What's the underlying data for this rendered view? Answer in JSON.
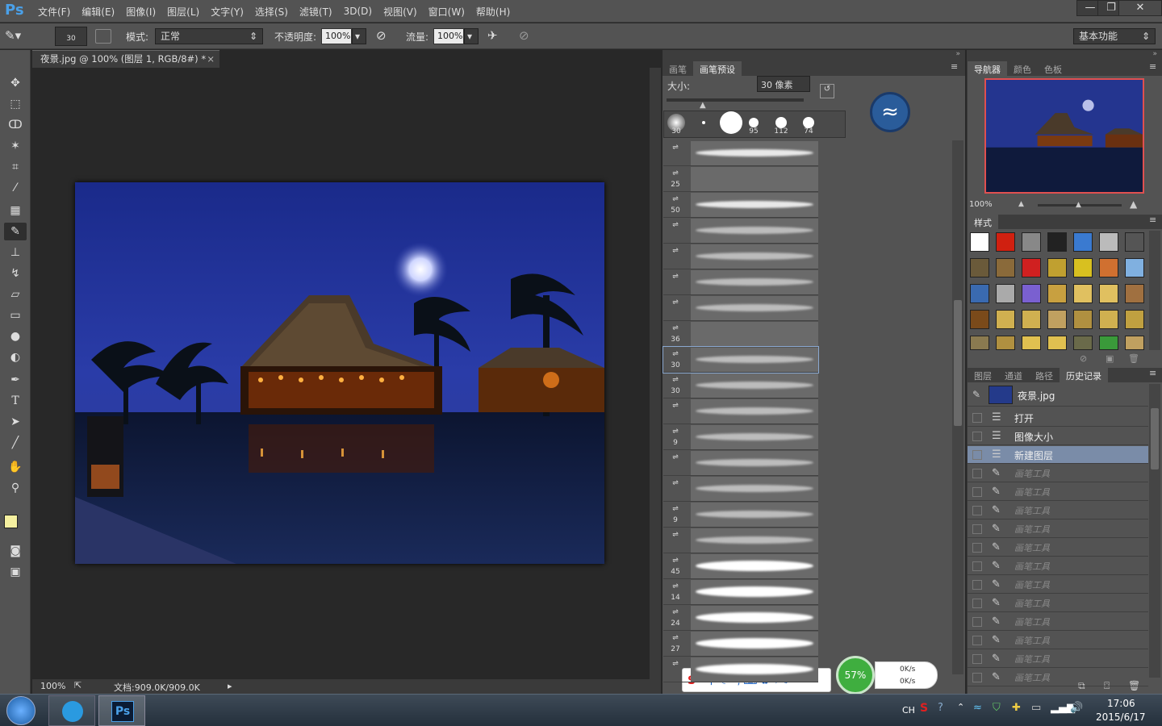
{
  "app": {
    "logo": "Ps"
  },
  "menu": [
    "文件(F)",
    "编辑(E)",
    "图像(I)",
    "图层(L)",
    "文字(Y)",
    "选择(S)",
    "滤镜(T)",
    "3D(D)",
    "视图(V)",
    "窗口(W)",
    "帮助(H)"
  ],
  "window_controls": {
    "minimize": "—",
    "restore": "❐",
    "close": "✕"
  },
  "options": {
    "brush_size": "30",
    "mode_label": "模式:",
    "mode_value": "正常",
    "opacity_label": "不透明度:",
    "opacity_value": "100%",
    "flow_label": "流量:",
    "flow_value": "100%",
    "workspace": "基本功能"
  },
  "document": {
    "tab_title": "夜景.jpg @ 100% (图层 1, RGB/8#) *",
    "zoom": "100%",
    "doc_info": "文档:909.0K/909.0K"
  },
  "brush_panel": {
    "tabs": [
      "画笔",
      "画笔预设"
    ],
    "active_tab": "画笔预设",
    "size_label": "大小:",
    "size_value": "30 像素",
    "top_presets": [
      "30",
      "",
      "",
      "95",
      "112",
      "74"
    ],
    "rows": [
      "",
      "25",
      "50",
      "",
      "",
      "",
      "",
      "36",
      "30",
      "30",
      "",
      "9",
      "",
      "",
      "9",
      "",
      "45",
      "14",
      "24",
      "27",
      ""
    ]
  },
  "navigator": {
    "tabs": [
      "导航器",
      "颜色",
      "色板"
    ],
    "zoom": "100%"
  },
  "styles_panel": {
    "tab": "样式"
  },
  "history": {
    "tabs": [
      "图层",
      "通道",
      "路径",
      "历史记录"
    ],
    "active_tab": "历史记录",
    "snapshot": "夜景.jpg",
    "items": [
      "打开",
      "图像大小",
      "新建图层",
      "画笔工具",
      "画笔工具",
      "画笔工具",
      "画笔工具",
      "画笔工具",
      "画笔工具",
      "画笔工具",
      "画笔工具",
      "画笔工具",
      "画笔工具",
      "画笔工具",
      "画笔工具"
    ],
    "selected_index": 2
  },
  "ime_toolbar": {
    "label": "中"
  },
  "net_widget": {
    "percent": "57%",
    "up": "0K/s",
    "down": "0K/s"
  },
  "taskbar": {
    "lang": "CH",
    "time": "17:06",
    "date": "2015/6/17",
    "ps_button": "Ps"
  }
}
